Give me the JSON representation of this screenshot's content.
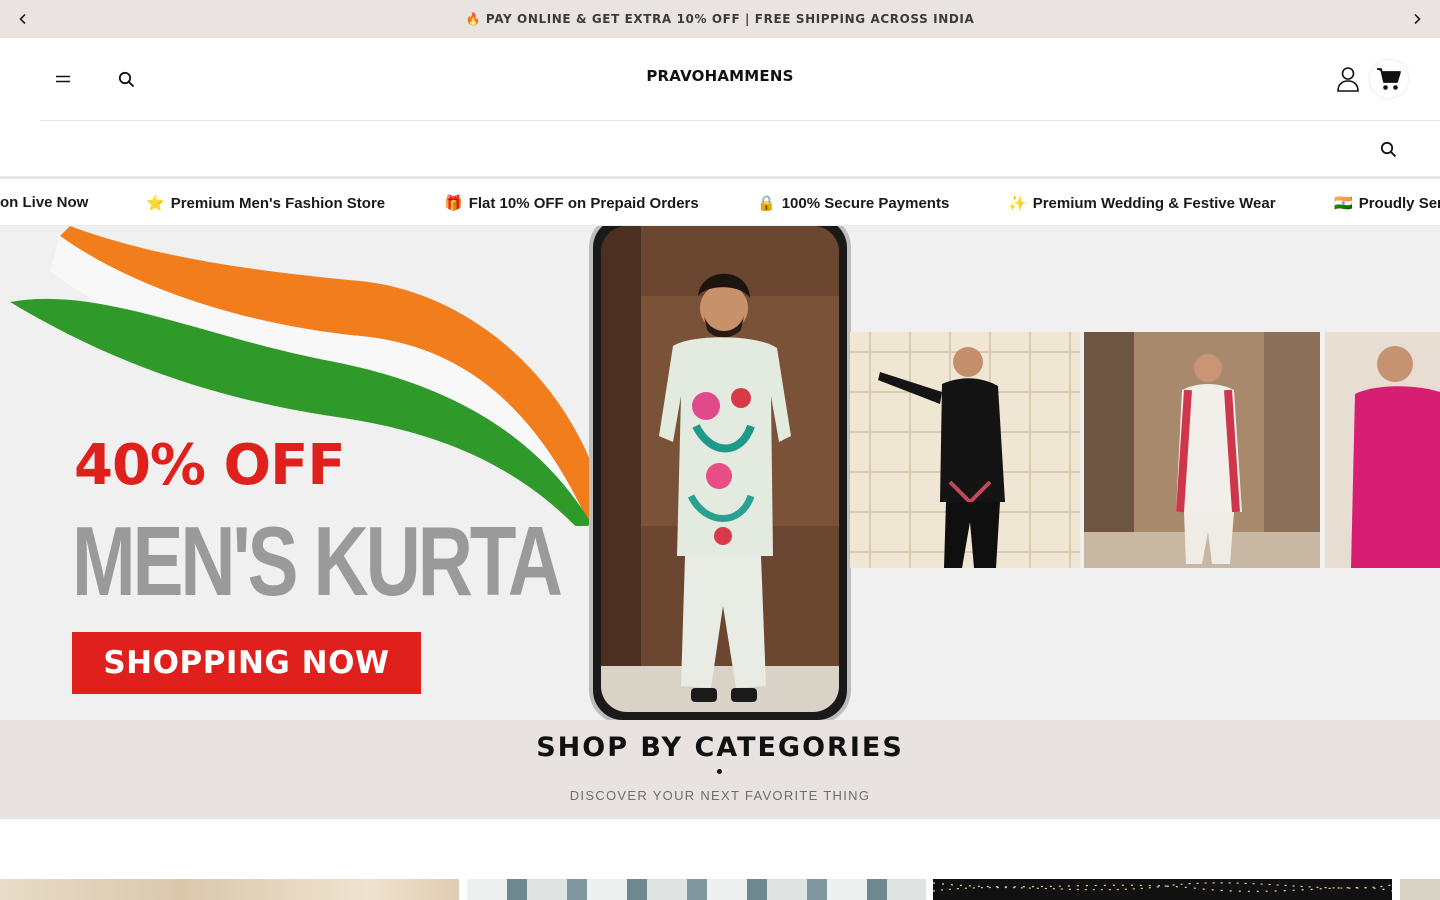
{
  "announcement": {
    "text": "🔥 PAY ONLINE & GET EXTRA 10% OFF | FREE SHIPPING ACROSS INDIA",
    "prev_icon": "chevron-left-icon",
    "next_icon": "chevron-right-icon"
  },
  "header": {
    "logo": "PRAVOHAMMENS",
    "menu_icon": "menu-icon",
    "search_icon": "search-icon",
    "account_icon": "user-icon",
    "cart_icon": "cart-icon"
  },
  "search": {
    "value": "",
    "icon": "search-icon"
  },
  "marquee": [
    {
      "emoji": "",
      "text": "on Live Now"
    },
    {
      "emoji": "⭐",
      "text": "Premium Men's Fashion Store"
    },
    {
      "emoji": "🎁",
      "text": "Flat 10% OFF on Prepaid Orders"
    },
    {
      "emoji": "🔒",
      "text": "100% Secure Payments"
    },
    {
      "emoji": "✨",
      "text": "Premium Wedding & Festive Wear"
    },
    {
      "emoji": "🇮🇳",
      "text": "Proudly Ser"
    }
  ],
  "hero": {
    "promo": "40% OFF",
    "headline": "MEN'S KURTA",
    "cta": "SHOPPING NOW",
    "accent_color": "#e0201d"
  },
  "categories": {
    "title": "SHOP BY CATEGORIES",
    "subtitle": "DISCOVER YOUR NEXT FAVORITE THING"
  },
  "colors": {
    "announcement_bg": "#e9e4e1",
    "categories_bg": "#e8e3e0",
    "promo_red": "#e0201d",
    "headline_grey": "#9a9a9a"
  }
}
